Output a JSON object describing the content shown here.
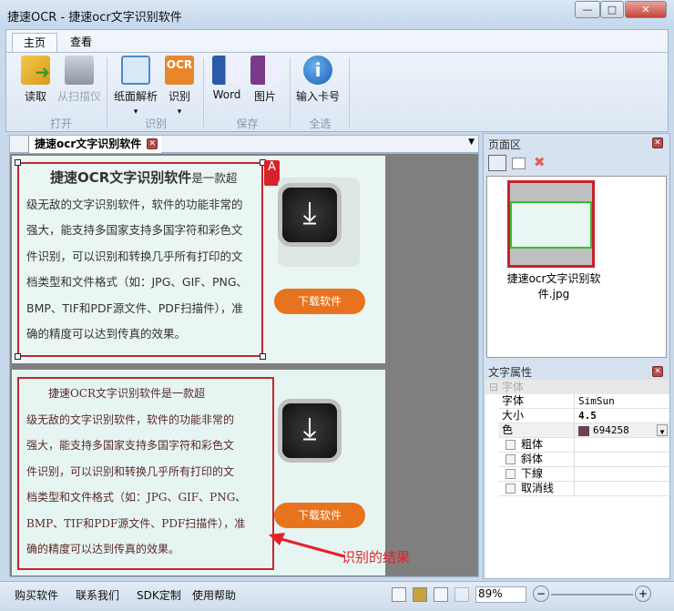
{
  "window": {
    "title": "捷速OCR - 捷速ocr文字识别软件",
    "minimize": "—",
    "maximize": "□",
    "close": "✕"
  },
  "ribbon": {
    "tabs": [
      {
        "label": "主页"
      },
      {
        "label": "查看"
      }
    ],
    "buttons": {
      "read": "读取",
      "scan": "从扫描仪",
      "parse": "纸面解析",
      "recognize": "识别",
      "word": "Word",
      "image": "图片",
      "serial": "输入卡号"
    },
    "ocr_icon_text": "OCR",
    "dropdown_arrow": "▾",
    "groups": {
      "open": "打开",
      "recognize": "识别",
      "save": "保存",
      "all": "全选"
    }
  },
  "doc": {
    "tab_label": "捷速ocr文字识别软件",
    "tab_close": "✕",
    "tab_menu": "▼",
    "original": {
      "title": "捷速OCR文字识别软件",
      "first_line_tail": "是一款超",
      "lines": [
        "级无敌的文字识别软件，软件的功能非常的",
        "强大，能支持多国家支持多国字符和彩色文",
        "件识别，可以识别和转换几乎所有打印的文",
        "档类型和文件格式（如：JPG、GIF、PNG、",
        "BMP、TIF和PDF源文件、PDF扫描件），准",
        "确的精度可以达到传真的效果。"
      ],
      "badge": "A",
      "download_label": "下载软件"
    },
    "result": {
      "lines": [
        "捷速OCR文字识别软件是一款超",
        "级无敌的文字识别软件，软件的功能非常的",
        "强大，能支持多国家支持多国字符和彩色文",
        "件识别，可以识别和转换几乎所有打印的文",
        "档类型和文件格式（如：JPG、GIF、PNG、",
        "BMP、TIF和PDF源文件、PDF扫描件），准",
        "确的精度可以达到传真的效果。"
      ],
      "download_label": "下载软件",
      "annotation": "识别的结果"
    }
  },
  "pages_panel": {
    "title": "页面区",
    "close": "✕",
    "delete_icon": "✖",
    "thumbnail_label": "捷速ocr文字识别软件.jpg"
  },
  "text_props": {
    "title": "文字属性",
    "close": "✕",
    "group": "字体",
    "group_toggle": "⊟",
    "rows": [
      {
        "key": "字体",
        "value": "SimSun"
      },
      {
        "key": "大小",
        "value": "4.5"
      },
      {
        "key": "色",
        "value": "694258"
      }
    ],
    "color_swatch": "#694258",
    "checkboxes": [
      "粗体",
      "斜体",
      "下線",
      "取消线"
    ]
  },
  "status": {
    "links": [
      "购买软件",
      "联系我们",
      "SDK定制",
      "使用帮助"
    ],
    "zoom": "89%",
    "zoom_out": "−",
    "zoom_in": "+"
  },
  "colors": {
    "accent": "#c0282c",
    "download": "#e8731e"
  }
}
